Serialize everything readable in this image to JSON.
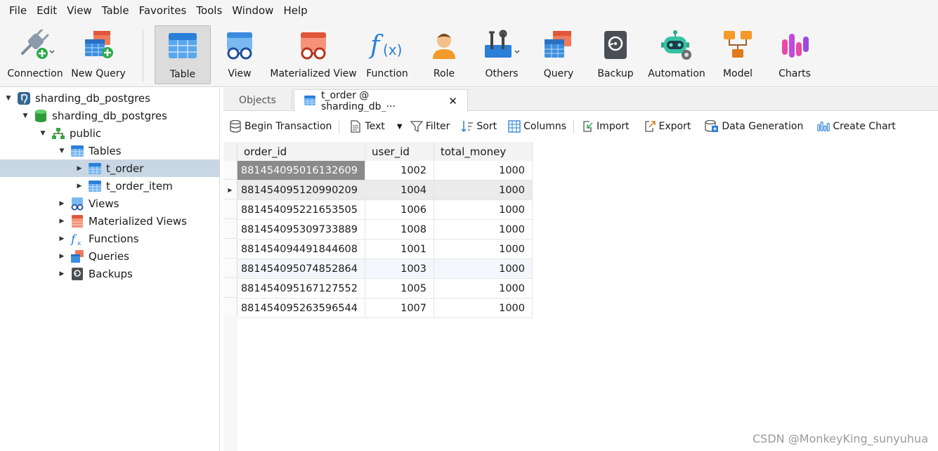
{
  "menu": [
    "File",
    "Edit",
    "View",
    "Table",
    "Favorites",
    "Tools",
    "Window",
    "Help"
  ],
  "toolbar": {
    "connection": "Connection",
    "new_query": "New Query",
    "table": "Table",
    "view": "View",
    "materialized_view": "Materialized View",
    "function": "Function",
    "role": "Role",
    "others": "Others",
    "query": "Query",
    "backup": "Backup",
    "automation": "Automation",
    "model": "Model",
    "charts": "Charts"
  },
  "tree": {
    "connection": "sharding_db_postgres",
    "database": "sharding_db_postgres",
    "schema": "public",
    "tables": "Tables",
    "table1": "t_order",
    "table2": "t_order_item",
    "views": "Views",
    "materialized_views": "Materialized Views",
    "functions": "Functions",
    "queries": "Queries",
    "backups": "Backups"
  },
  "tabs": {
    "objects": "Objects",
    "active": "t_order @ sharding_db_···",
    "close": "✕"
  },
  "actions": {
    "begin_transaction": "Begin Transaction",
    "text": "Text",
    "filter": "Filter",
    "sort": "Sort",
    "columns": "Columns",
    "import": "Import",
    "export": "Export",
    "data_generation": "Data Generation",
    "create_chart": "Create Chart"
  },
  "grid": {
    "columns": [
      "order_id",
      "user_id",
      "total_money"
    ],
    "rows": [
      [
        "881454095016132609",
        "1002",
        "1000"
      ],
      [
        "881454095120990209",
        "1004",
        "1000"
      ],
      [
        "881454095221653505",
        "1006",
        "1000"
      ],
      [
        "881454095309733889",
        "1008",
        "1000"
      ],
      [
        "881454094491844608",
        "1001",
        "1000"
      ],
      [
        "881454095074852864",
        "1003",
        "1000"
      ],
      [
        "881454095167127552",
        "1005",
        "1000"
      ],
      [
        "881454095263596544",
        "1007",
        "1000"
      ]
    ]
  },
  "watermark": "CSDN @MonkeyKing_sunyuhua",
  "colors": {
    "accent_blue": "#2a8ae0",
    "selection": "#c9d6e3",
    "selected_cell": "#8a8a8a"
  }
}
